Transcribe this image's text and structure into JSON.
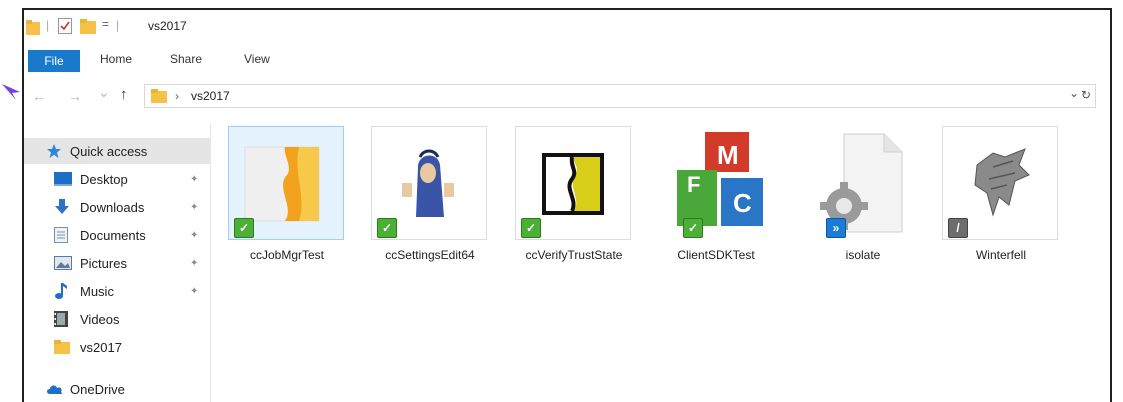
{
  "window": {
    "title": "vs2017",
    "title_separator": "|",
    "qa_dropdown": "="
  },
  "ribbon": {
    "tabs": [
      "File",
      "Home",
      "Share",
      "View"
    ]
  },
  "address": {
    "back_icon": "←",
    "forward_icon": "→",
    "recent_icon": "⌄",
    "up_icon": "↑",
    "breadcrumb_separator": "›",
    "path": "vs2017",
    "dropdown_icon": "⌄",
    "refresh_icon": "↻"
  },
  "sidebar": {
    "items": [
      {
        "label": "Quick access",
        "icon": "star-icon",
        "pinned": false,
        "selected": true
      },
      {
        "label": "Desktop",
        "icon": "desktop-icon",
        "pinned": true,
        "selected": false
      },
      {
        "label": "Downloads",
        "icon": "download-arrow-icon",
        "pinned": true,
        "selected": false
      },
      {
        "label": "Documents",
        "icon": "document-icon",
        "pinned": true,
        "selected": false
      },
      {
        "label": "Pictures",
        "icon": "pictures-icon",
        "pinned": true,
        "selected": false
      },
      {
        "label": "Music",
        "icon": "music-note-icon",
        "pinned": true,
        "selected": false
      },
      {
        "label": "Videos",
        "icon": "video-icon",
        "pinned": false,
        "selected": false
      },
      {
        "label": "vs2017",
        "icon": "folder-icon",
        "pinned": false,
        "selected": false
      },
      {
        "label": "OneDrive",
        "icon": "cloud-icon",
        "pinned": false,
        "selected": false
      }
    ],
    "pin_glyph": "📌"
  },
  "files": [
    {
      "name": "ccJobMgrTest",
      "badge": "check",
      "selected": true,
      "thumb": "orange-page-thumbnail"
    },
    {
      "name": "ccSettingsEdit64",
      "badge": "check",
      "selected": false,
      "thumb": "cartoon-figure-thumbnail"
    },
    {
      "name": "ccVerifyTrustState",
      "badge": "check",
      "selected": false,
      "thumb": "yellow-black-frame-thumbnail"
    },
    {
      "name": "ClientSDKTest",
      "badge": "check",
      "selected": false,
      "thumb": "mfc-cubes-icon"
    },
    {
      "name": "isolate",
      "badge": "run",
      "selected": false,
      "thumb": "gear-page-icon"
    },
    {
      "name": "Winterfell",
      "badge": "ignore",
      "selected": false,
      "thumb": "wolf-sigil-thumbnail"
    }
  ],
  "badges": {
    "check": "✓",
    "run": "»",
    "ignore": "/"
  },
  "colors": {
    "file_tab": "#1979ca",
    "badge_ok": "#4caf36",
    "badge_run": "#1a7bd9",
    "badge_ignore": "#6d6d6d",
    "pointer_arrow": "#7a3fe0"
  }
}
